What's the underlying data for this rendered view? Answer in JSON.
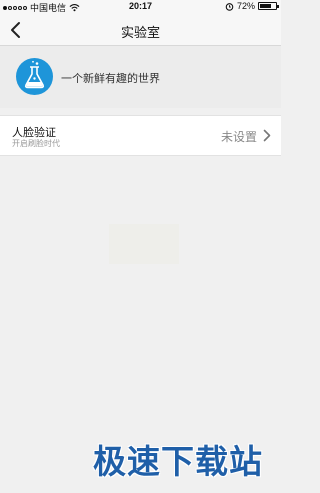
{
  "status_bar": {
    "signal_dots_filled": 1,
    "signal_dots_total": 5,
    "carrier": "中国电信",
    "time": "20:17",
    "battery_text": "72%",
    "battery_level": 0.72,
    "icons": [
      "wifi-icon",
      "alarm-icon",
      "battery-icon"
    ]
  },
  "nav": {
    "title": "实验室",
    "back_icon": "back-chevron-icon"
  },
  "header": {
    "icon": "lab-flask-icon",
    "icon_color": "#1e95d9",
    "slogan": "一个新鲜有趣的世界"
  },
  "face_row": {
    "title": "人脸验证",
    "subtitle": "开启刷脸时代",
    "status": "未设置",
    "chevron_icon": "chevron-right-icon"
  },
  "watermark": {
    "text": "极速下载站",
    "color": "#1f5fa8"
  }
}
